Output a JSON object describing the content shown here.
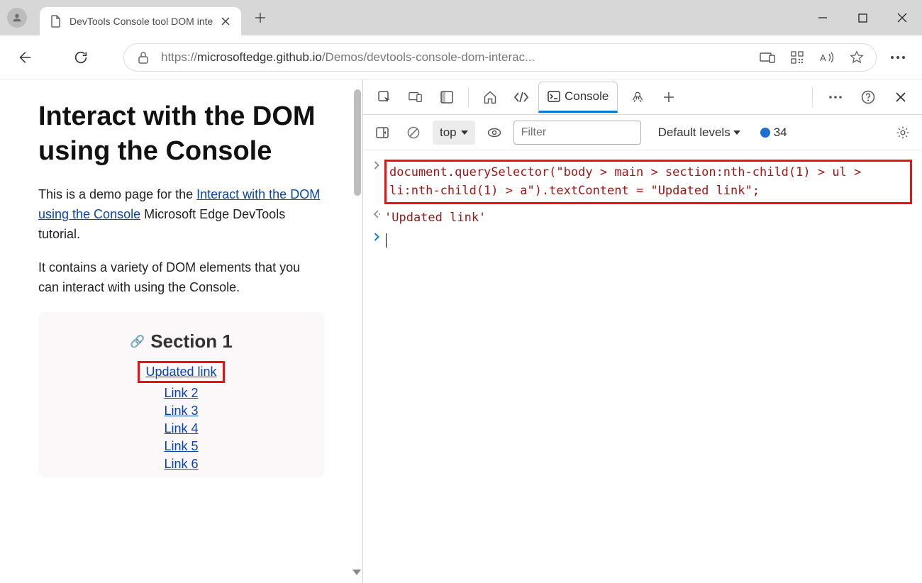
{
  "window": {
    "tab_title": "DevTools Console tool DOM inte",
    "url_prefix": "https://",
    "url_host": "microsoftedge.github.io",
    "url_path": "/Demos/devtools-console-dom-interac..."
  },
  "page": {
    "h1": "Interact with the DOM using the Console",
    "p1_a": "This is a demo page for the ",
    "p1_link": "Interact with the DOM using the Console",
    "p1_b": " Microsoft Edge DevTools tutorial.",
    "p2": "It contains a variety of DOM elements that you can interact with using the Console.",
    "section_title": "Section 1",
    "links": [
      "Updated link",
      "Link 2",
      "Link 3",
      "Link 4",
      "Link 5",
      "Link 6"
    ]
  },
  "devtools": {
    "tab_console": "Console",
    "dropdown_context": "top",
    "filter_placeholder": "Filter",
    "levels": "Default levels",
    "issues_count": "34",
    "code_line": "document.querySelector(\"body > main > section:nth-child(1) > ul > li:nth-child(1) > a\").textContent = \"Updated link\";",
    "result": "'Updated link'"
  }
}
